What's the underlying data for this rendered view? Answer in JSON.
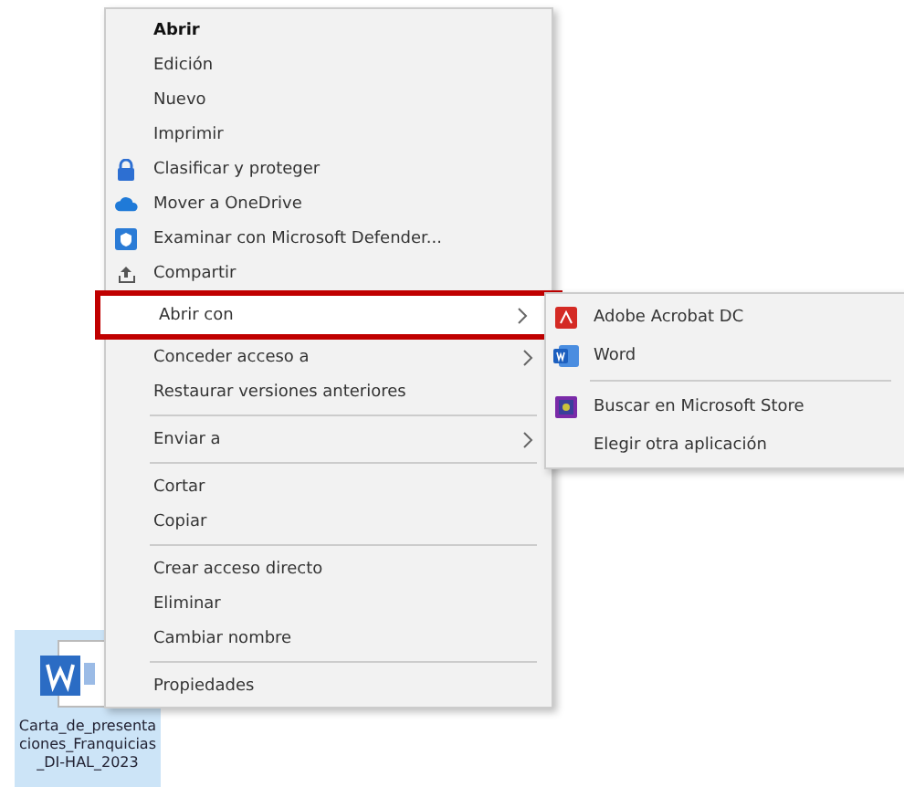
{
  "menu": {
    "items": [
      {
        "kind": "item",
        "label": "Abrir",
        "bold": true
      },
      {
        "kind": "item",
        "label": "Edición"
      },
      {
        "kind": "item",
        "label": "Nuevo"
      },
      {
        "kind": "item",
        "label": "Imprimir"
      },
      {
        "kind": "item",
        "label": "Clasificar y proteger"
      },
      {
        "kind": "item",
        "label": "Mover a OneDrive"
      },
      {
        "kind": "item",
        "label": "Examinar con Microsoft Defender..."
      },
      {
        "kind": "item",
        "label": "Compartir"
      },
      {
        "kind": "item",
        "label": "Abrir con",
        "submenu": true,
        "selected": true
      },
      {
        "kind": "item",
        "label": "Conceder acceso a",
        "submenu": true
      },
      {
        "kind": "item",
        "label": "Restaurar versiones anteriores"
      },
      {
        "kind": "separator"
      },
      {
        "kind": "item",
        "label": "Enviar a",
        "submenu": true
      },
      {
        "kind": "separator"
      },
      {
        "kind": "item",
        "label": "Cortar"
      },
      {
        "kind": "item",
        "label": "Copiar"
      },
      {
        "kind": "separator"
      },
      {
        "kind": "item",
        "label": "Crear acceso directo"
      },
      {
        "kind": "item",
        "label": "Eliminar"
      },
      {
        "kind": "item",
        "label": "Cambiar nombre"
      },
      {
        "kind": "separator"
      },
      {
        "kind": "item",
        "label": "Propiedades"
      }
    ]
  },
  "submenu": {
    "items": [
      {
        "kind": "item",
        "label": "Adobe Acrobat DC"
      },
      {
        "kind": "item",
        "label": "Word"
      },
      {
        "kind": "separator"
      },
      {
        "kind": "item",
        "label": "Buscar en Microsoft Store"
      },
      {
        "kind": "item",
        "label": "Elegir otra aplicación"
      }
    ]
  },
  "desktop_file": {
    "name": "Carta_de_presentaciones_Franquicias_DI-HAL_2023",
    "selected": true
  }
}
